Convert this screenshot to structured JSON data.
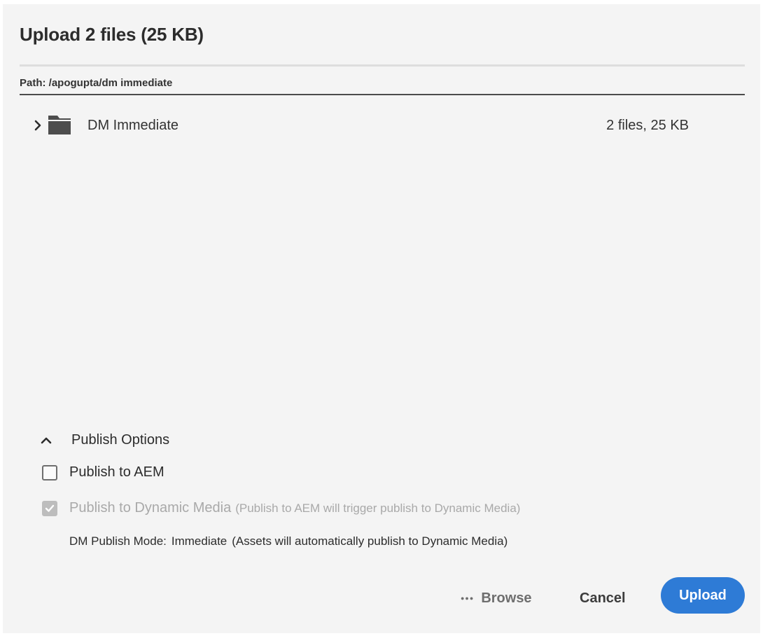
{
  "dialog": {
    "title": "Upload 2 files (25 KB)",
    "path": "Path: /apogupta/dm immediate"
  },
  "folder_row": {
    "name": "DM Immediate",
    "size": "2 files, 25 KB",
    "expanded": false
  },
  "publish_options": {
    "header": "Publish Options",
    "expanded": true,
    "publish_to_aem": {
      "label": "Publish to AEM",
      "checked": false
    },
    "publish_to_dm": {
      "label": "Publish to Dynamic Media",
      "note": "(Publish to AEM will trigger publish to Dynamic Media)",
      "checked": true,
      "disabled": true
    },
    "dm_mode": {
      "label": "DM Publish Mode:",
      "value": "Immediate",
      "note": "(Assets will automatically publish to Dynamic Media)"
    }
  },
  "footer": {
    "browse_label": "Browse",
    "cancel_label": "Cancel",
    "upload_label": "Upload"
  },
  "colors": {
    "accent": "#2e7bd6",
    "background": "#f4f4f4"
  },
  "icons": {
    "expand": "chevron-right-icon",
    "folder": "folder-icon",
    "collapse": "chevron-up-icon",
    "more": "more-dots-icon",
    "check": "checkmark-icon"
  }
}
